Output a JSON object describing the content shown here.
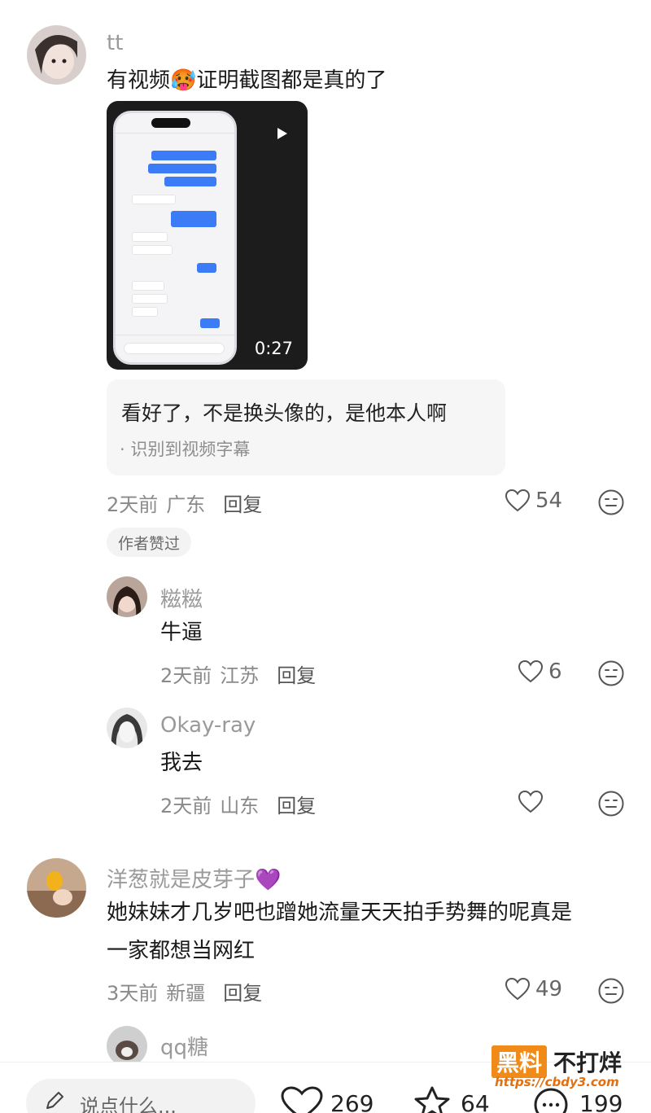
{
  "comments": [
    {
      "username": "tt",
      "content": "有视频🥵证明截图都是真的了",
      "video": {
        "duration": "0:27"
      },
      "subtitle": {
        "text": "看好了，不是换头像的，是他本人啊",
        "note": "· 识别到视频字幕"
      },
      "time": "2天前",
      "location": "广东",
      "reply_label": "回复",
      "likes": "54",
      "badge": "作者赞过"
    },
    {
      "username": "糍糍",
      "content": "牛逼",
      "time": "2天前",
      "location": "江苏",
      "reply_label": "回复",
      "likes": "6"
    },
    {
      "username": "Okay-ray",
      "content": "我去",
      "time": "2天前",
      "location": "山东",
      "reply_label": "回复",
      "likes": ""
    },
    {
      "username": "洋葱就是皮芽子💜",
      "content_line1": "她妹妹才几岁吧也蹭她流量天天拍手势舞的呢真是",
      "content_line2": "一家都想当网红",
      "time": "3天前",
      "location": "新疆",
      "reply_label": "回复",
      "likes": "49"
    },
    {
      "username": "qq糖"
    }
  ],
  "bottom_bar": {
    "input_placeholder": "说点什么...",
    "likes": "269",
    "favorites": "64",
    "comments": "199"
  },
  "watermark": {
    "box_text": "黑料",
    "text": "不打烊",
    "url": "https://cbdy3.com"
  },
  "colors": {
    "accent_blue": "#3b7bf6",
    "watermark_orange": "#f08a18"
  }
}
